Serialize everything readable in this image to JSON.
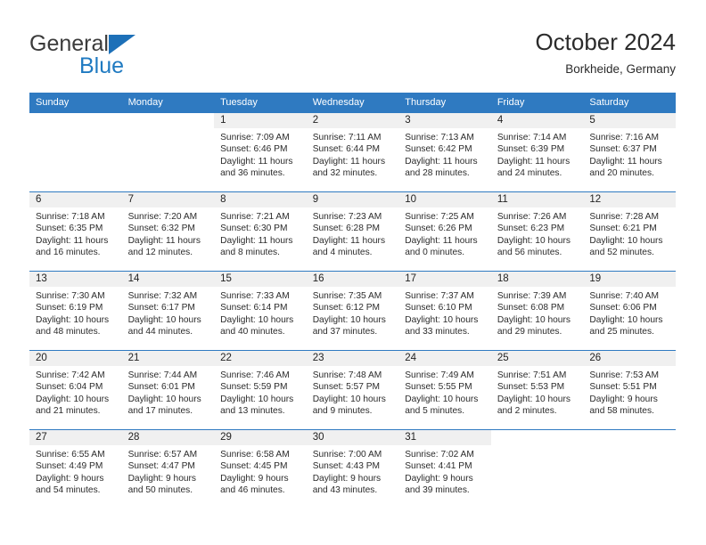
{
  "brand": {
    "name_top": "General",
    "name_bottom": "Blue",
    "accent_color": "#1f7ac1",
    "triangle_icon": "triangle-icon"
  },
  "header": {
    "title": "October 2024",
    "subtitle": "Borkheide, Germany"
  },
  "calendar": {
    "header_bg": "#2f7ac1",
    "header_text_color": "#ffffff",
    "daynum_band_bg": "#f0f0f0",
    "week_separator_color": "#2f7ac1",
    "weekdays": [
      "Sunday",
      "Monday",
      "Tuesday",
      "Wednesday",
      "Thursday",
      "Friday",
      "Saturday"
    ],
    "weeks": [
      [
        {
          "day": "",
          "blank": true
        },
        {
          "day": "",
          "blank": true
        },
        {
          "day": "1",
          "sunrise": "Sunrise: 7:09 AM",
          "sunset": "Sunset: 6:46 PM",
          "daylight1": "Daylight: 11 hours",
          "daylight2": "and 36 minutes."
        },
        {
          "day": "2",
          "sunrise": "Sunrise: 7:11 AM",
          "sunset": "Sunset: 6:44 PM",
          "daylight1": "Daylight: 11 hours",
          "daylight2": "and 32 minutes."
        },
        {
          "day": "3",
          "sunrise": "Sunrise: 7:13 AM",
          "sunset": "Sunset: 6:42 PM",
          "daylight1": "Daylight: 11 hours",
          "daylight2": "and 28 minutes."
        },
        {
          "day": "4",
          "sunrise": "Sunrise: 7:14 AM",
          "sunset": "Sunset: 6:39 PM",
          "daylight1": "Daylight: 11 hours",
          "daylight2": "and 24 minutes."
        },
        {
          "day": "5",
          "sunrise": "Sunrise: 7:16 AM",
          "sunset": "Sunset: 6:37 PM",
          "daylight1": "Daylight: 11 hours",
          "daylight2": "and 20 minutes."
        }
      ],
      [
        {
          "day": "6",
          "sunrise": "Sunrise: 7:18 AM",
          "sunset": "Sunset: 6:35 PM",
          "daylight1": "Daylight: 11 hours",
          "daylight2": "and 16 minutes."
        },
        {
          "day": "7",
          "sunrise": "Sunrise: 7:20 AM",
          "sunset": "Sunset: 6:32 PM",
          "daylight1": "Daylight: 11 hours",
          "daylight2": "and 12 minutes."
        },
        {
          "day": "8",
          "sunrise": "Sunrise: 7:21 AM",
          "sunset": "Sunset: 6:30 PM",
          "daylight1": "Daylight: 11 hours",
          "daylight2": "and 8 minutes."
        },
        {
          "day": "9",
          "sunrise": "Sunrise: 7:23 AM",
          "sunset": "Sunset: 6:28 PM",
          "daylight1": "Daylight: 11 hours",
          "daylight2": "and 4 minutes."
        },
        {
          "day": "10",
          "sunrise": "Sunrise: 7:25 AM",
          "sunset": "Sunset: 6:26 PM",
          "daylight1": "Daylight: 11 hours",
          "daylight2": "and 0 minutes."
        },
        {
          "day": "11",
          "sunrise": "Sunrise: 7:26 AM",
          "sunset": "Sunset: 6:23 PM",
          "daylight1": "Daylight: 10 hours",
          "daylight2": "and 56 minutes."
        },
        {
          "day": "12",
          "sunrise": "Sunrise: 7:28 AM",
          "sunset": "Sunset: 6:21 PM",
          "daylight1": "Daylight: 10 hours",
          "daylight2": "and 52 minutes."
        }
      ],
      [
        {
          "day": "13",
          "sunrise": "Sunrise: 7:30 AM",
          "sunset": "Sunset: 6:19 PM",
          "daylight1": "Daylight: 10 hours",
          "daylight2": "and 48 minutes."
        },
        {
          "day": "14",
          "sunrise": "Sunrise: 7:32 AM",
          "sunset": "Sunset: 6:17 PM",
          "daylight1": "Daylight: 10 hours",
          "daylight2": "and 44 minutes."
        },
        {
          "day": "15",
          "sunrise": "Sunrise: 7:33 AM",
          "sunset": "Sunset: 6:14 PM",
          "daylight1": "Daylight: 10 hours",
          "daylight2": "and 40 minutes."
        },
        {
          "day": "16",
          "sunrise": "Sunrise: 7:35 AM",
          "sunset": "Sunset: 6:12 PM",
          "daylight1": "Daylight: 10 hours",
          "daylight2": "and 37 minutes."
        },
        {
          "day": "17",
          "sunrise": "Sunrise: 7:37 AM",
          "sunset": "Sunset: 6:10 PM",
          "daylight1": "Daylight: 10 hours",
          "daylight2": "and 33 minutes."
        },
        {
          "day": "18",
          "sunrise": "Sunrise: 7:39 AM",
          "sunset": "Sunset: 6:08 PM",
          "daylight1": "Daylight: 10 hours",
          "daylight2": "and 29 minutes."
        },
        {
          "day": "19",
          "sunrise": "Sunrise: 7:40 AM",
          "sunset": "Sunset: 6:06 PM",
          "daylight1": "Daylight: 10 hours",
          "daylight2": "and 25 minutes."
        }
      ],
      [
        {
          "day": "20",
          "sunrise": "Sunrise: 7:42 AM",
          "sunset": "Sunset: 6:04 PM",
          "daylight1": "Daylight: 10 hours",
          "daylight2": "and 21 minutes."
        },
        {
          "day": "21",
          "sunrise": "Sunrise: 7:44 AM",
          "sunset": "Sunset: 6:01 PM",
          "daylight1": "Daylight: 10 hours",
          "daylight2": "and 17 minutes."
        },
        {
          "day": "22",
          "sunrise": "Sunrise: 7:46 AM",
          "sunset": "Sunset: 5:59 PM",
          "daylight1": "Daylight: 10 hours",
          "daylight2": "and 13 minutes."
        },
        {
          "day": "23",
          "sunrise": "Sunrise: 7:48 AM",
          "sunset": "Sunset: 5:57 PM",
          "daylight1": "Daylight: 10 hours",
          "daylight2": "and 9 minutes."
        },
        {
          "day": "24",
          "sunrise": "Sunrise: 7:49 AM",
          "sunset": "Sunset: 5:55 PM",
          "daylight1": "Daylight: 10 hours",
          "daylight2": "and 5 minutes."
        },
        {
          "day": "25",
          "sunrise": "Sunrise: 7:51 AM",
          "sunset": "Sunset: 5:53 PM",
          "daylight1": "Daylight: 10 hours",
          "daylight2": "and 2 minutes."
        },
        {
          "day": "26",
          "sunrise": "Sunrise: 7:53 AM",
          "sunset": "Sunset: 5:51 PM",
          "daylight1": "Daylight: 9 hours",
          "daylight2": "and 58 minutes."
        }
      ],
      [
        {
          "day": "27",
          "sunrise": "Sunrise: 6:55 AM",
          "sunset": "Sunset: 4:49 PM",
          "daylight1": "Daylight: 9 hours",
          "daylight2": "and 54 minutes."
        },
        {
          "day": "28",
          "sunrise": "Sunrise: 6:57 AM",
          "sunset": "Sunset: 4:47 PM",
          "daylight1": "Daylight: 9 hours",
          "daylight2": "and 50 minutes."
        },
        {
          "day": "29",
          "sunrise": "Sunrise: 6:58 AM",
          "sunset": "Sunset: 4:45 PM",
          "daylight1": "Daylight: 9 hours",
          "daylight2": "and 46 minutes."
        },
        {
          "day": "30",
          "sunrise": "Sunrise: 7:00 AM",
          "sunset": "Sunset: 4:43 PM",
          "daylight1": "Daylight: 9 hours",
          "daylight2": "and 43 minutes."
        },
        {
          "day": "31",
          "sunrise": "Sunrise: 7:02 AM",
          "sunset": "Sunset: 4:41 PM",
          "daylight1": "Daylight: 9 hours",
          "daylight2": "and 39 minutes."
        },
        {
          "day": "",
          "blank": true
        },
        {
          "day": "",
          "blank": true
        }
      ]
    ]
  }
}
